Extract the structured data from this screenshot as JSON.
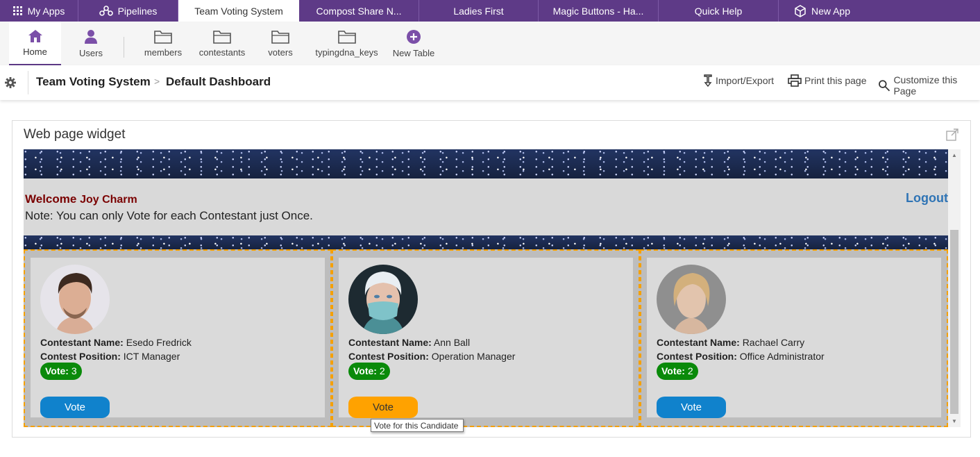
{
  "top_tabs": [
    {
      "label": "My Apps",
      "icon": "grid-icon"
    },
    {
      "label": "Pipelines",
      "icon": "pipelines-icon"
    },
    {
      "label": "Team Voting System",
      "active": true
    },
    {
      "label": "Compost  Share  N..."
    },
    {
      "label": "Ladies First"
    },
    {
      "label": "Magic Buttons - Ha..."
    },
    {
      "label": "Quick Help"
    },
    {
      "label": "New App",
      "icon": "cube-icon"
    }
  ],
  "table_bar": {
    "home": "Home",
    "users": "Users",
    "tables": [
      "members",
      "contestants",
      "voters",
      "typingdna_keys"
    ],
    "new_table": "New Table"
  },
  "breadcrumb": {
    "app": "Team Voting System",
    "separator": ">",
    "page": "Default Dashboard"
  },
  "actions": {
    "import_export": "Import/Export",
    "print": "Print this page",
    "customize": "Customize this Page"
  },
  "widget": {
    "title": "Web page widget",
    "welcome_prefix": "Welcome ",
    "welcome_name": "Joy Charm",
    "note": "Note: You can only Vote for each Contestant just Once.",
    "logout": "Logout",
    "name_label": "Contestant Name:",
    "position_label": "Contest Position:",
    "vote_label": "Vote:",
    "vote_button": "Vote",
    "contestants": [
      {
        "name": "Esedo Fredrick",
        "position": "ICT Manager",
        "votes": "3"
      },
      {
        "name": "Ann Ball",
        "position": "Operation Manager",
        "votes": "2"
      },
      {
        "name": "Rachael Carry",
        "position": "Office Administrator",
        "votes": "2"
      }
    ],
    "tooltip": "Vote for this  Candidate"
  },
  "colors": {
    "brand_purple": "#5e3a87",
    "vote_button_blue": "#1082cc",
    "vote_button_hover": "#ffa200",
    "vote_badge_green": "#0a8a0a",
    "welcome_red": "#7a0000",
    "logout_blue": "#2f74b5",
    "card_border_dashed": "#f5a000"
  }
}
